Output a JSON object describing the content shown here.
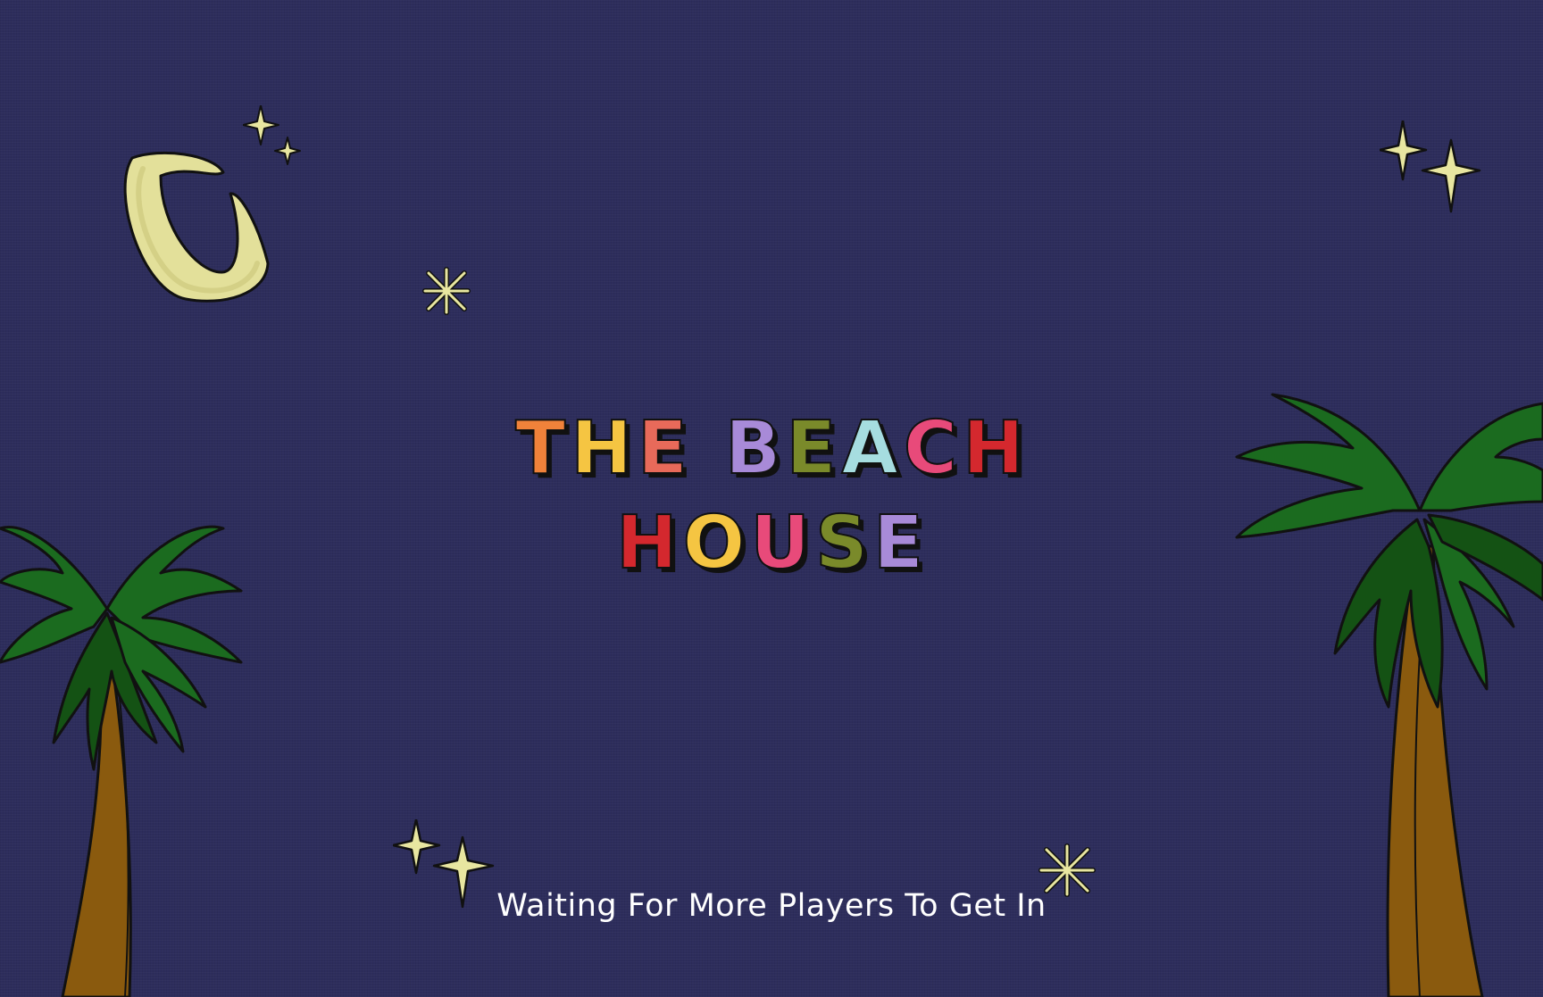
{
  "title": {
    "line1": [
      {
        "ch": "T",
        "color": "#f0823a"
      },
      {
        "ch": "H",
        "color": "#f5c542"
      },
      {
        "ch": "E",
        "color": "#e86a5a"
      },
      {
        "ch": " ",
        "color": "#000000"
      },
      {
        "ch": "B",
        "color": "#a88ad8"
      },
      {
        "ch": "E",
        "color": "#7a8a2a"
      },
      {
        "ch": "A",
        "color": "#a6dde0"
      },
      {
        "ch": "C",
        "color": "#e84a7a"
      },
      {
        "ch": "H",
        "color": "#d4282e"
      }
    ],
    "line2": [
      {
        "ch": "H",
        "color": "#d4282e"
      },
      {
        "ch": "O",
        "color": "#f5c542"
      },
      {
        "ch": "U",
        "color": "#e84a7a"
      },
      {
        "ch": "S",
        "color": "#7a8a2a"
      },
      {
        "ch": "E",
        "color": "#a88ad8"
      }
    ]
  },
  "status": {
    "text": "Waiting For More Players To Get In"
  },
  "decorations": {
    "moon": "crescent-moon-icon",
    "stars": "sparkle-star-icon",
    "bursts": "starburst-icon",
    "trees": "palm-tree-icon"
  },
  "colors": {
    "background": "#2d2d5c",
    "star": "#e8e6a0",
    "moon": "#e3e09a",
    "palm_leaf": "#1b6b1f",
    "palm_leaf_dark": "#145214",
    "palm_trunk": "#8a5a0e",
    "outline": "#111111",
    "status_text": "#ffffff"
  }
}
